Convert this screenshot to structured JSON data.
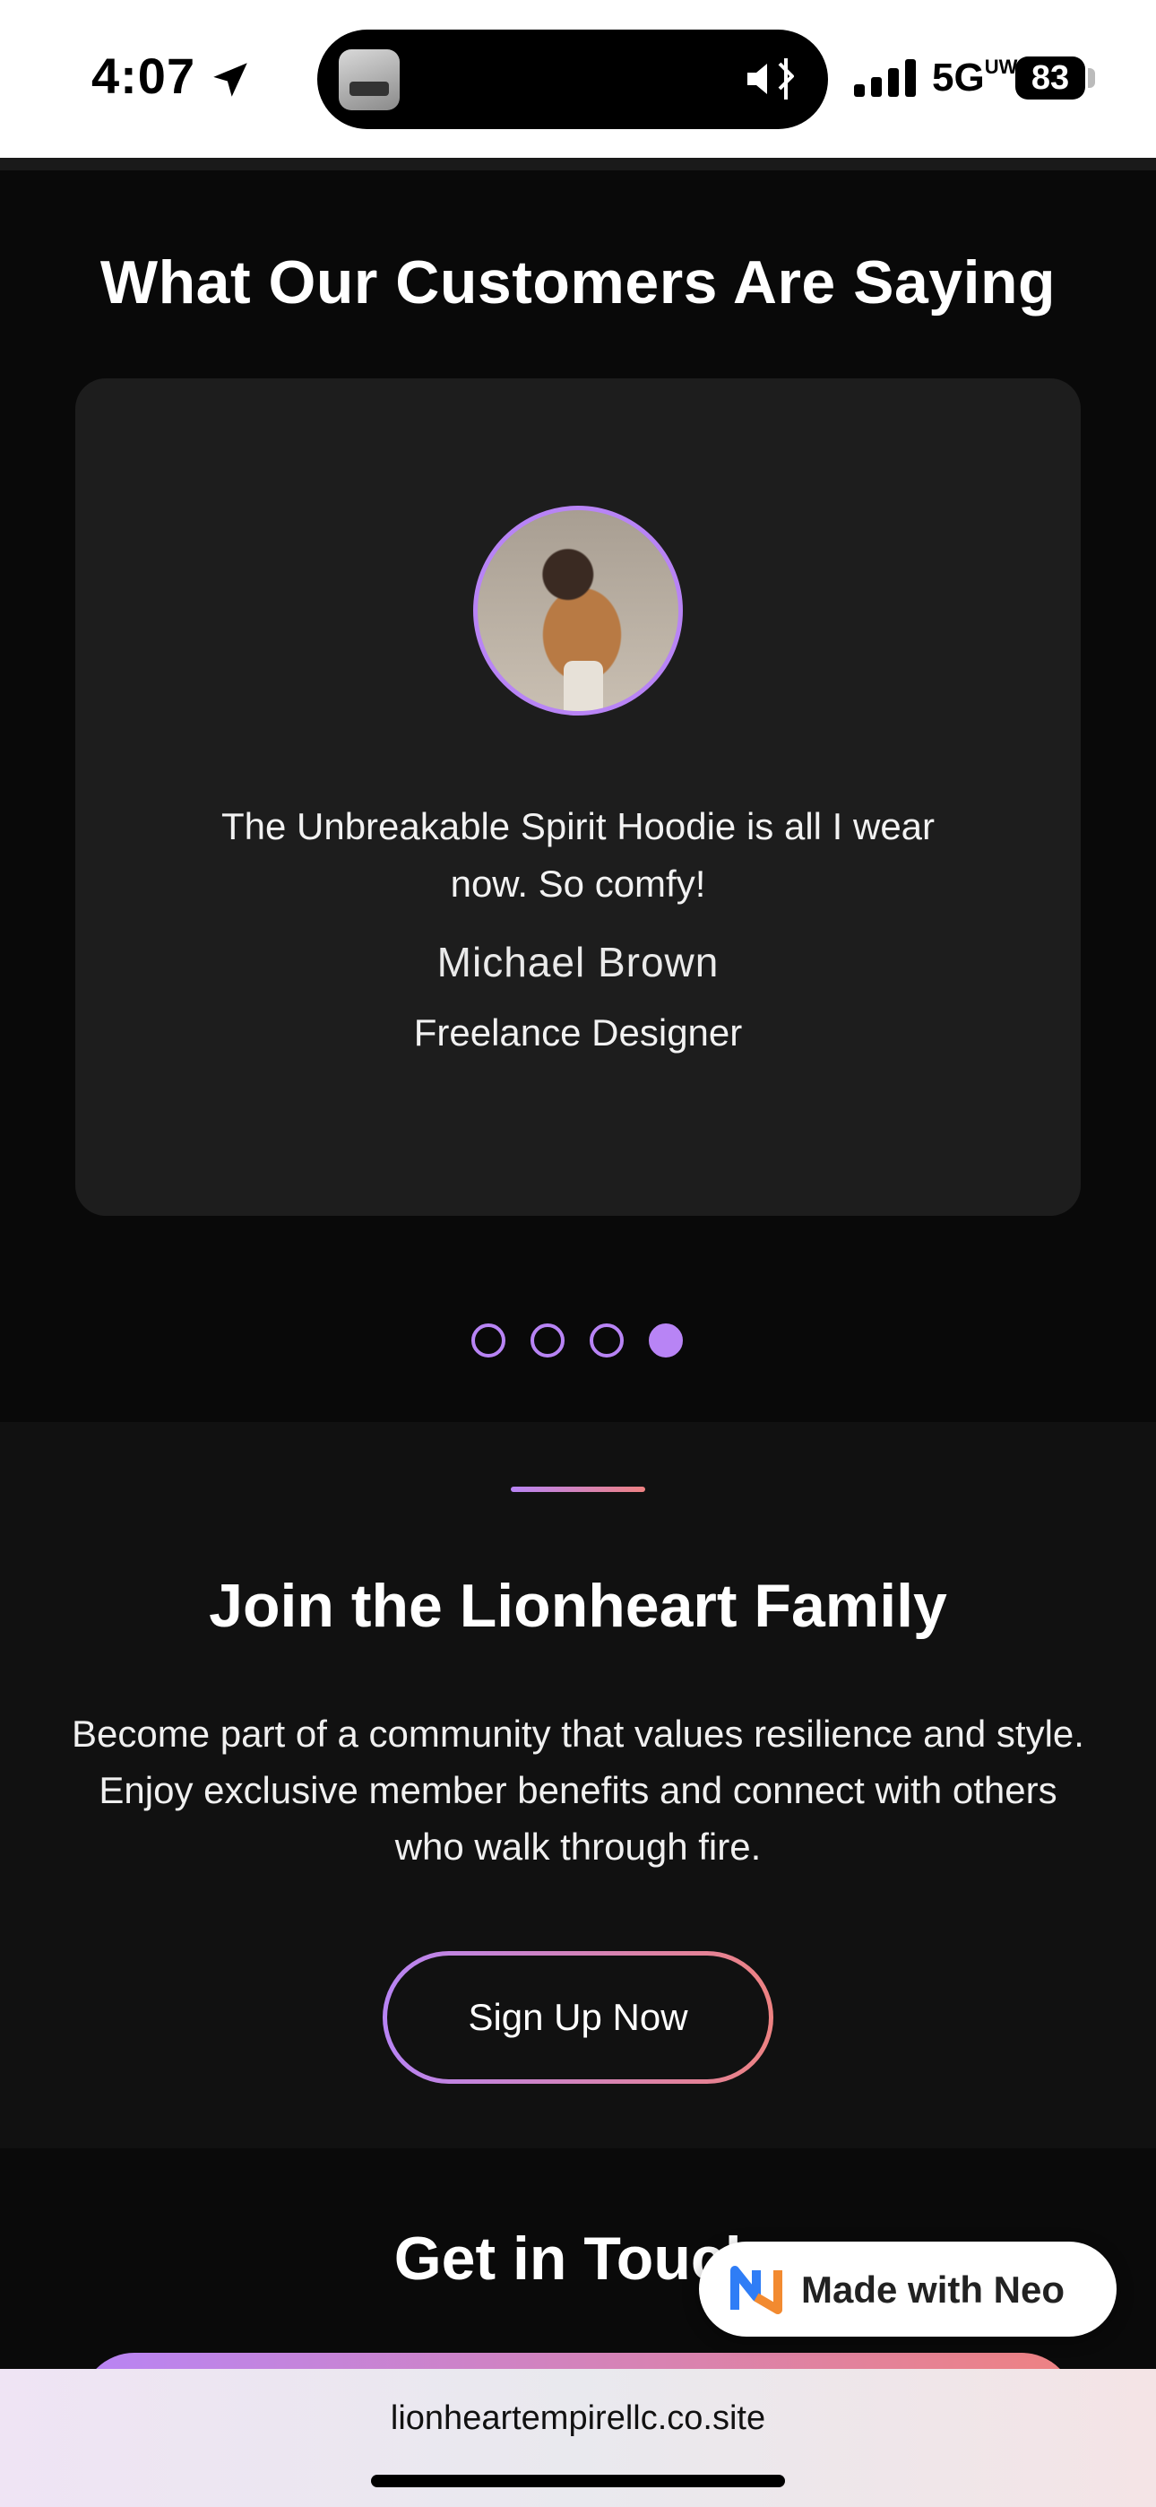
{
  "status_bar": {
    "time": "4:07",
    "network": "5G",
    "network_sup": "UW",
    "battery": "83",
    "icons": [
      "location-arrow-icon",
      "now-playing-thumbnail",
      "silent-mode-icon",
      "bluetooth-icon",
      "cellular-signal-icon",
      "battery-icon"
    ]
  },
  "testimonials": {
    "title": "What Our Customers Are Saying",
    "quote": "The Unbreakable Spirit Hoodie is all I wear now. So comfy!",
    "name": "Michael Brown",
    "role": "Freelance Designer",
    "slide_count": 4,
    "active_slide": 4
  },
  "join": {
    "title": "Join the Lionheart Family",
    "text": "Become part of a community that values resilience and style. Enjoy exclusive member benefits and connect with others who walk through fire.",
    "button_label": "Sign Up Now"
  },
  "contact": {
    "title": "Get in Touch"
  },
  "badge": {
    "label": "Made with Neo"
  },
  "browser": {
    "url": "lionheartempirellc.co.site"
  },
  "colors": {
    "accent_purple": "#b884f5",
    "accent_coral": "#ee8282",
    "card_bg": "#1d1d1d"
  }
}
